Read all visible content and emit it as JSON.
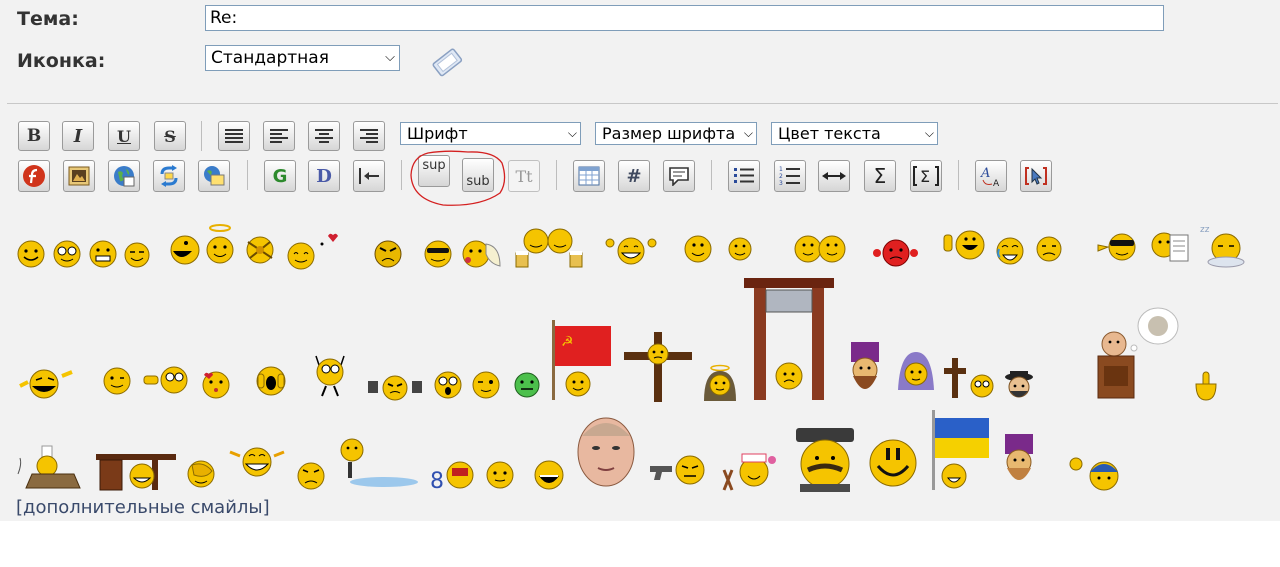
{
  "form": {
    "subject_label": "Тема:",
    "subject_value": "Re:",
    "icon_label": "Иконка:",
    "icon_selected": "Стандартная"
  },
  "toolbar": {
    "font_select": "Шрифт",
    "size_select": "Размер шрифта",
    "color_select": "Цвет текста",
    "sup_label": "sup",
    "sub_label": "sub",
    "tt_label": "Tt",
    "hash_label": "#",
    "sigma_label": "Σ",
    "bold_label": "B",
    "italic_label": "I",
    "underline_label": "U",
    "strike_label": "S",
    "google_label": "G",
    "d_label": "D"
  },
  "accent": {
    "annotation_circle": "#d42020",
    "smiley_yellow": "#f5c400",
    "link_color": "#3a4a6b"
  },
  "more_smileys_link": "[дополнительные смайлы]"
}
